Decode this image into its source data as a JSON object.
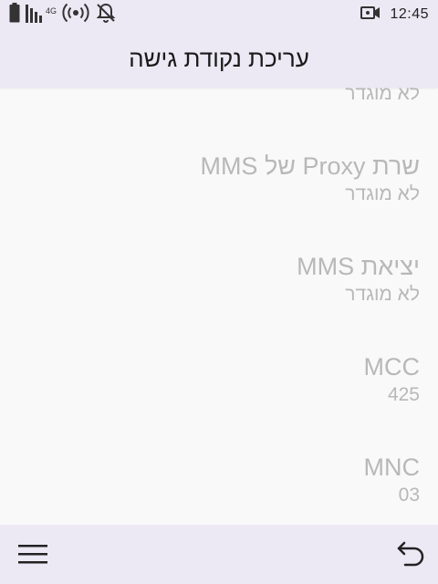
{
  "status_bar": {
    "network_type": "4G",
    "time": "12:45",
    "icons": [
      "battery-icon",
      "signal-icon",
      "hotspot-icon",
      "notifications-off-icon",
      "video-call-icon"
    ]
  },
  "header": {
    "title": "עריכת נקודת גישה"
  },
  "preferences": [
    {
      "title": "",
      "summary": "לא מוגדר"
    },
    {
      "title": "שרת Proxy של MMS",
      "summary": "לא מוגדר"
    },
    {
      "title": "יציאת MMS",
      "summary": "לא מוגדר"
    },
    {
      "title": "MCC",
      "summary": "425"
    },
    {
      "title": "MNC",
      "summary": "03"
    }
  ],
  "bottom_bar": {
    "icons": [
      "menu-icon",
      "back-icon"
    ]
  }
}
